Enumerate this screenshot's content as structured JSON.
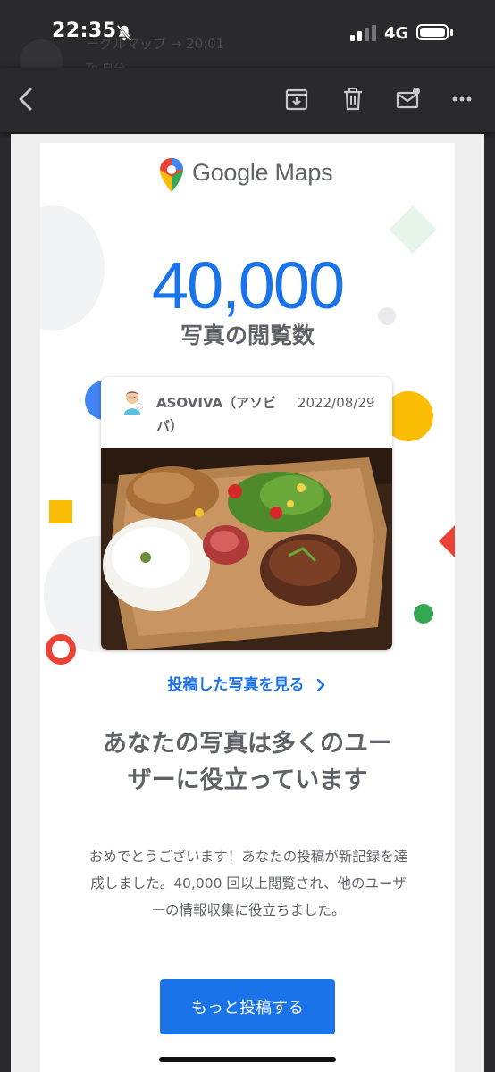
{
  "status_bar": {
    "time": "22:35",
    "network": "4G",
    "behind_sender": "ーグルマップ → 20:01",
    "behind_recipient": "To 自分"
  },
  "toolbar": {
    "icons": [
      "back-icon",
      "archive-icon",
      "trash-icon",
      "mark-unread-icon",
      "more-icon"
    ]
  },
  "email": {
    "logo_text": "Google Maps",
    "view_count": "40,000",
    "view_label": "写真の閲覧数",
    "post": {
      "author": "ASOVIVA（アソビバ）",
      "date": "2022/08/29"
    },
    "view_photo_link": "投稿した写真を見る",
    "headline": "あなたの写真は多くのユーザーに役立っています",
    "body": "おめでとうございます！あなたの投稿が新記録を達成しました。40,000 回以上閲覧され、他のユーザーの情報収集に役立ちました。",
    "cta_label": "もっと投稿する"
  },
  "colors": {
    "accent": "#1a73e8",
    "text_gray": "#5f6368",
    "dark_bar": "#2a2a2c"
  }
}
